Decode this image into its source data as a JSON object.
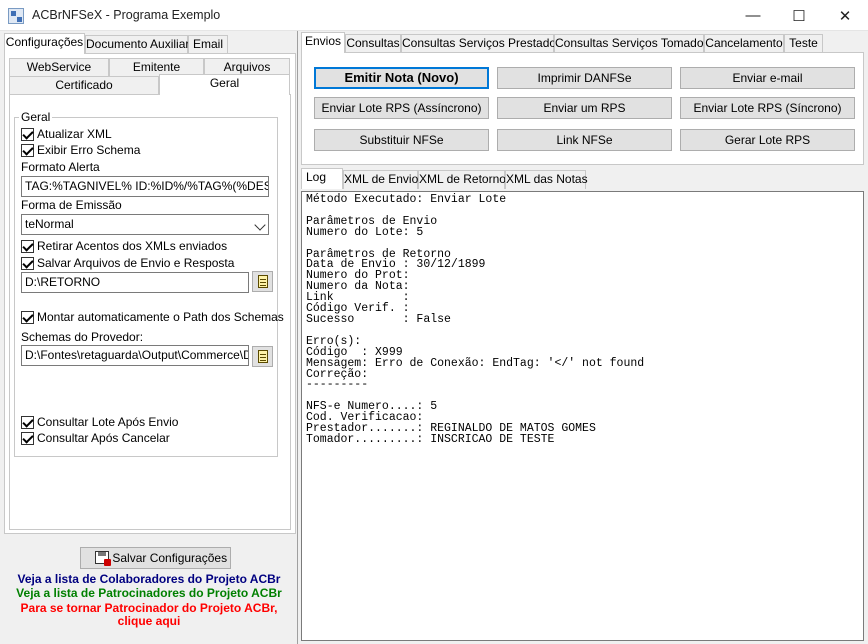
{
  "window": {
    "title": "ACBrNFSeX - Programa Exemplo"
  },
  "left": {
    "tabs": [
      "Configurações",
      "Documento Auxiliar",
      "Email"
    ],
    "subtabs_row1": [
      "WebService",
      "Emitente",
      "Arquivos"
    ],
    "subtabs_row2": [
      "Certificado",
      "Geral"
    ],
    "group_title": "Geral",
    "atualizar_xml": "Atualizar XML",
    "exibir_erro_schema": "Exibir Erro Schema",
    "formato_alerta_label": "Formato Alerta",
    "formato_alerta_value": "TAG:%TAGNIVEL% ID:%ID%/%TAG%(%DESCRI",
    "forma_emissao_label": "Forma de Emissão",
    "forma_emissao_value": "teNormal",
    "retirar_acentos": "Retirar Acentos dos XMLs enviados",
    "salvar_arquivos": "Salvar Arquivos de Envio e Resposta",
    "path_retorno": "D:\\RETORNO",
    "montar_path": "Montar automaticamente o Path dos Schemas",
    "schemas_label": "Schemas do Provedor:",
    "schemas_value": "D:\\Fontes\\retaguarda\\Output\\Commerce\\Debu",
    "consultar_lote": "Consultar Lote Após Envio",
    "consultar_cancelar": "Consultar Após Cancelar",
    "salvar_button": "Salvar Configurações",
    "link_colaboradores": "Veja a lista de Colaboradores do Projeto ACBr",
    "link_patrocinadores": "Veja a lista de Patrocinadores do Projeto ACBr",
    "link_patrocinador_1": "Para se tornar Patrocinador do Projeto ACBr,",
    "link_patrocinador_2": "clique aqui"
  },
  "right": {
    "tabs": [
      "Envios",
      "Consultas",
      "Consultas Serviços Prestados",
      "Consultas Serviços Tomados",
      "Cancelamento",
      "Teste"
    ],
    "buttons": [
      "Emitir Nota (Novo)",
      "Imprimir DANFSe",
      "Enviar e-mail",
      "Enviar Lote RPS (Assíncrono)",
      "Enviar um RPS",
      "Enviar Lote RPS (Síncrono)",
      "Substituir NFSe",
      "Link NFSe",
      "Gerar Lote RPS"
    ],
    "log_tabs": [
      "Log",
      "XML de Envio",
      "XML de Retorno",
      "XML das Notas"
    ],
    "log_text": "Método Executado: Enviar Lote\n\nParâmetros de Envio\nNumero do Lote: 5\n\nParâmetros de Retorno\nData de Envio : 30/12/1899\nNumero do Prot:\nNumero da Nota:\nLink          :\nCódigo Verif. :\nSucesso       : False\n\nErro(s):\nCódigo  : X999\nMensagem: Erro de Conexão: EndTag: '</' not found\nCorreção:\n---------\n\nNFS-e Numero....: 5\nCod. Verificacao:\nPrestador.......: REGINALDO DE MATOS GOMES\nTomador.........: INSCRICAO DE TESTE"
  },
  "colors": {
    "link_blue": "#000080",
    "link_green": "#008000",
    "link_red": "#ff0000",
    "focus_border": "#0078d7"
  }
}
